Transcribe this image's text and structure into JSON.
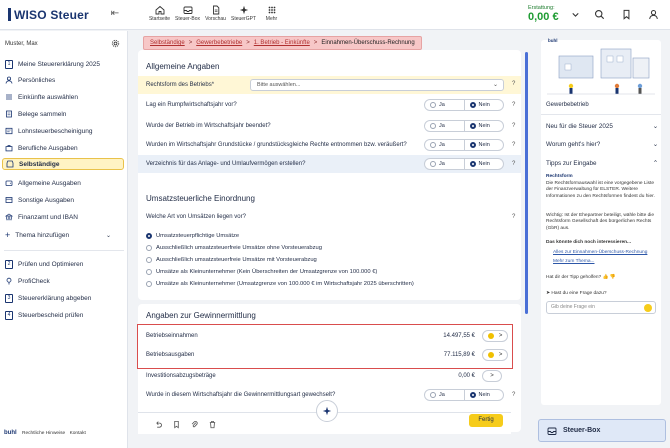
{
  "app": {
    "logo": "WISO Steuer"
  },
  "topnav": [
    {
      "label": "Startseite",
      "icon": "home-icon"
    },
    {
      "label": "Steuer-Box",
      "icon": "inbox-icon"
    },
    {
      "label": "Vorschau",
      "icon": "document-icon"
    },
    {
      "label": "SteuerGPT",
      "icon": "sparkle-icon"
    },
    {
      "label": "Mehr",
      "icon": "grid-icon"
    }
  ],
  "refund": {
    "label": "Erstattung:",
    "value": "0,00 €"
  },
  "sidebar": {
    "user": "Muster, Max",
    "items": [
      {
        "label": "Meine Steuererklärung 2025",
        "num": "1"
      },
      {
        "label": "Persönliches"
      },
      {
        "label": "Einkünfte auswählen"
      },
      {
        "label": "Belege sammeln"
      },
      {
        "label": "Lohnsteuerbescheinigung"
      },
      {
        "label": "Berufliche Ausgaben"
      },
      {
        "label": "Selbständige"
      },
      {
        "label": "Allgemeine Ausgaben"
      },
      {
        "label": "Sonstige Ausgaben"
      },
      {
        "label": "Finanzamt und IBAN"
      },
      {
        "label": "Thema hinzufügen"
      },
      {
        "label": "Prüfen und Optimieren",
        "num": "2"
      },
      {
        "label": "ProfiCheck"
      },
      {
        "label": "Steuererklärung abgeben",
        "num": "3"
      },
      {
        "label": "Steuerbescheid prüfen",
        "num": "4"
      }
    ],
    "footer": {
      "brand": "buhl",
      "links": [
        "Rechtliche Hinweise",
        "Kontakt"
      ]
    }
  },
  "breadcrumb": [
    "Selbständige",
    "Gewerbebetriebe",
    "1. Betrieb - Einkünfte",
    "Einnahmen-Überschuss-Rechnung"
  ],
  "section1": {
    "title": "Allgemeine Angaben",
    "rechtsform_label": "Rechtsform des Betriebs*",
    "rechtsform_placeholder": "Bitte auswählen...",
    "questions": [
      {
        "text": "Lag ein Rumpfwirtschaftsjahr vor?",
        "yes": "Ja",
        "no": "Nein"
      },
      {
        "text": "Wurde der Betrieb im Wirtschaftsjahr beendet?",
        "yes": "Ja",
        "no": "Nein"
      },
      {
        "text": "Wurden im Wirtschaftsjahr Grundstücke / grundstücksgleiche Rechte entnommen bzw. veräußert?",
        "yes": "Ja",
        "no": "Nein"
      },
      {
        "text": "Verzeichnis für das Anlage- und Umlaufvermögen erstellen?",
        "yes": "Ja",
        "no": "Nein"
      }
    ]
  },
  "section2": {
    "title": "Umsatzsteuerliche Einordnung",
    "question": "Welche Art von Umsätzen liegen vor?",
    "options": [
      "Umsatzsteuerpflichtige Umsätze",
      "Ausschließlich umsatzsteuerfreie Umsätze ohne Vorsteuerabzug",
      "Ausschließlich umsatzsteuerfreie Umsätze mit Vorsteuerabzug",
      "Umsätze als Kleinunternehmer (Kein Überschreiten der Umsatzgrenze von 100.000 €)",
      "Umsätze als Kleinunternehmer (Umsatzgrenze von 100.000 € im Wirtschaftsjahr 2025 überschritten)"
    ]
  },
  "section3": {
    "title": "Angaben zur Gewinnermittlung",
    "rows": [
      {
        "label": "Betriebseinnahmen",
        "amount": "14.497,55 €"
      },
      {
        "label": "Betriebsausgaben",
        "amount": "77.115,89 €"
      },
      {
        "label": "Investitionsabzugsbeträge",
        "amount": "0,00 €"
      }
    ],
    "question": {
      "text": "Wurde in diesem Wirtschaftsjahr die Gewinnermittlungsart gewechselt?",
      "yes": "Ja",
      "no": "Nein"
    }
  },
  "actions": {
    "done": "Fertig"
  },
  "help": {
    "illustration_caption": "Gewerbebetrieb",
    "sections": [
      "Neu für die Steuer 2025",
      "Worum geht's hier?",
      "Tipps zur Eingabe"
    ],
    "tip_title": "Rechtsform",
    "tip_text": "Die Rechtsformauswahl ist eine vorgegebene Liste der Finanzverwaltung für ELSTER. Weitere Informationen zu den Rechtsformen findest du hier.",
    "warn_text": "Wichtig: Ist der Ehepartner beteiligt, wähle bitte die Rechtsform Gesellschaft des bürgerlichen Rechts (GbR) aus.",
    "interest_title": "Das könnte dich noch interessieren...",
    "links": [
      "Alles zur Einnahmen-Überschuss-Rechnung",
      "Mehr zum Thema..."
    ],
    "feedback": "Hat dir der Tipp geholfen?",
    "ask_label": "Hast du eine Frage dazu?",
    "ask_placeholder": "Gib deine Frage ein",
    "steuerbox": "Steuer-Box"
  },
  "colors": {
    "brand": "#1a3570",
    "accent": "#f6cc1b",
    "refund": "#1e9c33",
    "highlight": "#d94d4d"
  }
}
